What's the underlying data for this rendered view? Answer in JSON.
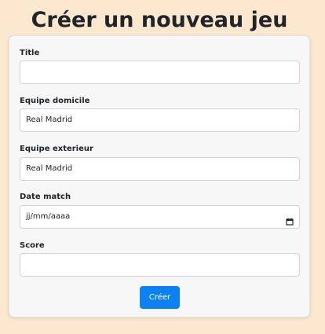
{
  "page": {
    "title": "Créer un nouveau jeu"
  },
  "form": {
    "fields": [
      {
        "label": "Title",
        "value": ""
      },
      {
        "label": "Equipe domicile",
        "value": "Real Madrid"
      },
      {
        "label": "Equipe exterieur",
        "value": "Real Madrid"
      },
      {
        "label": "Date match",
        "value": "jj/mm/aaaa",
        "icon": "calendar-icon"
      },
      {
        "label": "Score",
        "value": ""
      }
    ],
    "submit_label": "Créer"
  },
  "colors": {
    "background": "#fbe8cf",
    "card": "#f7f7f7",
    "primary": "#0d80f2"
  }
}
